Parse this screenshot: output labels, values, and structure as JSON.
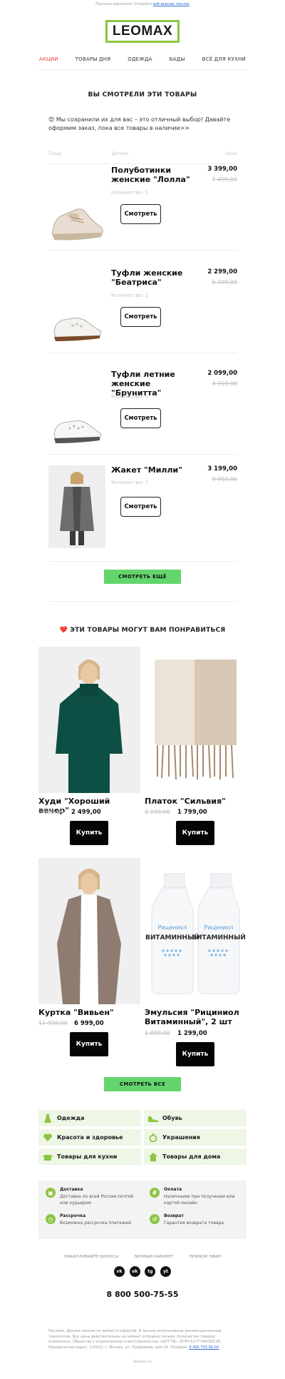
{
  "preheader": {
    "text": "Пропали картинки? Откройте",
    "link": "веб-версию письма"
  },
  "brand": {
    "logo": "LEOMAX",
    "accent": "#8cc541"
  },
  "nav": [
    {
      "label": "АКЦИИ",
      "active": true
    },
    {
      "label": "ТОВАРЫ ДНЯ"
    },
    {
      "label": "ОДЕЖДА"
    },
    {
      "label": "БАДЫ"
    },
    {
      "label": "ВСЁ ДЛЯ КУХНИ"
    }
  ],
  "viewed": {
    "title": "ВЫ СМОТРЕЛИ ЭТИ ТОВАРЫ",
    "text": "😍 Мы сохранили их для вас – это отличный выбор! Давайте оформим заказ, пока все товары в наличии>>",
    "col_product": "Товар",
    "col_details": "Детали",
    "col_price": "Цена",
    "items": [
      {
        "name": "Полуботинки женские \"Лолла\"",
        "qty": "Количество: 1",
        "price": "3 399,00",
        "old": "7 499,00",
        "button": "Смотреть"
      },
      {
        "name": "Туфли женские \"Беатриса\"",
        "qty": "Количество: 1",
        "price": "2 299,00",
        "old": "5 399,00",
        "button": "Смотреть"
      },
      {
        "name": "Туфли летние женские \"Брунитта\"",
        "qty": "Количество: 1",
        "price": "2 099,00",
        "old": "4 999,00",
        "button": "Смотреть"
      },
      {
        "name": "Жакет \"Милли\"",
        "qty": "Количество: 1",
        "price": "3 199,00",
        "old": "9 999,00",
        "button": "Смотреть"
      }
    ],
    "more_button": "СМОТРЕТЬ ЕЩЁ"
  },
  "recommend": {
    "title": "❤️ ЭТИ ТОВАРЫ МОГУТ ВАМ ПОНРАВИТЬСЯ",
    "items": [
      {
        "name": "Худи \"Хороший вечер\"",
        "old": "2 999,00",
        "price": "2 499,00",
        "button": "Купить"
      },
      {
        "name": "Платок \"Сильвия\"",
        "old": "2 199,00",
        "price": "1 799,00",
        "button": "Купить"
      },
      {
        "name": "Куртка \"Вивьен\"",
        "old": "11 999,00",
        "price": "6 999,00",
        "button": "Купить"
      },
      {
        "name": "Эмульсия \"Рициниол Витаминный\", 2 шт",
        "old": "1 899,00",
        "price": "1 299,00",
        "button": "Купить"
      }
    ],
    "bottle_brand": "Рициниол",
    "bottle_label": "ВИТАМИННЫЙ",
    "all_button": "СМОТРЕТЬ ВСЕ"
  },
  "categories": [
    {
      "label": "Одежда",
      "icon": "dress-icon"
    },
    {
      "label": "Обувь",
      "icon": "shoe-icon"
    },
    {
      "label": "Красота и здоровье",
      "icon": "heart-icon"
    },
    {
      "label": "Украшения",
      "icon": "diamond-icon"
    },
    {
      "label": "Товары для кухни",
      "icon": "pot-icon"
    },
    {
      "label": "Товары для дома",
      "icon": "house-icon"
    }
  ],
  "info": [
    {
      "title": "Доставка",
      "text": "Доставка по всей России почтой или курьером",
      "icon": "box-icon"
    },
    {
      "title": "Оплата",
      "text": "Наличными при получении или картой онлайн",
      "icon": "ruble-icon"
    },
    {
      "title": "Рассрочка",
      "text": "Возможна рассрочка платежей",
      "icon": "clock-icon"
    },
    {
      "title": "Возврат",
      "text": "Гарантия возврата товара",
      "icon": "return-icon"
    }
  ],
  "footer_nav": [
    "НАКАПЛИВАЙТЕ БОНУСЫ",
    "ЛИЧНЫЙ КАБИНЕТ",
    "ПРЯМОЙ ЭФИР"
  ],
  "socials": [
    {
      "label": "vk",
      "icon": "vk-icon"
    },
    {
      "label": "ok",
      "icon": "ok-icon"
    },
    {
      "label": "tg",
      "icon": "telegram-icon"
    },
    {
      "label": "yt",
      "icon": "youtube-icon"
    }
  ],
  "phone": "8 800 500-75-55",
  "legal": {
    "text": "Реклама. Данное письмо не является офертой. В письме использованы рекомендательные технологии. Все цены действительны на момент отправки письма. Количество товаров ограничено. Общество с ограниченной ответственностью «ЦОТ ТВ», ОГРН 5177746038128. Юридический адрес: 115432, г. Москва, ул. Трофимова, дом 24. Телефон:",
    "phone_link": "8 495 755-56-02"
  },
  "footer_site": "leomax.ru"
}
